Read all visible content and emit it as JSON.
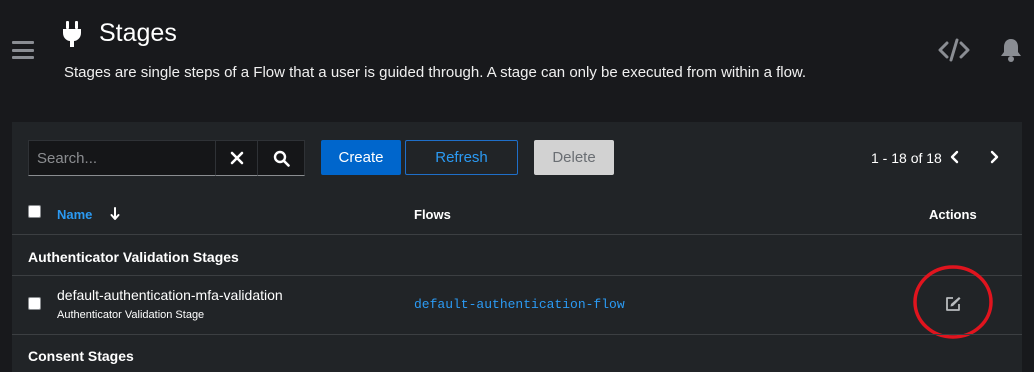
{
  "header": {
    "title": "Stages",
    "description": "Stages are single steps of a Flow that a user is guided through. A stage can only be executed from within a flow.",
    "icons": {
      "menu": "hamburger-menu-icon",
      "page": "plug-icon",
      "api": "code-icon",
      "notifications": "bell-icon"
    }
  },
  "toolbar": {
    "search_placeholder": "Search...",
    "search_value": "",
    "create_label": "Create",
    "refresh_label": "Refresh",
    "delete_label": "Delete",
    "pagination": "1 - 18 of 18"
  },
  "table": {
    "columns": {
      "name": "Name",
      "flows": "Flows",
      "actions": "Actions"
    },
    "groups": [
      {
        "title": "Authenticator Validation Stages",
        "rows": [
          {
            "name": "default-authentication-mfa-validation",
            "type": "Authenticator Validation Stage",
            "flow": "default-authentication-flow"
          }
        ]
      },
      {
        "title": "Consent Stages",
        "rows": []
      }
    ]
  },
  "colors": {
    "background": "#18191c",
    "card": "#212427",
    "primary": "#0066cc",
    "link": "#2b9af3",
    "annotation": "#e0141e"
  }
}
